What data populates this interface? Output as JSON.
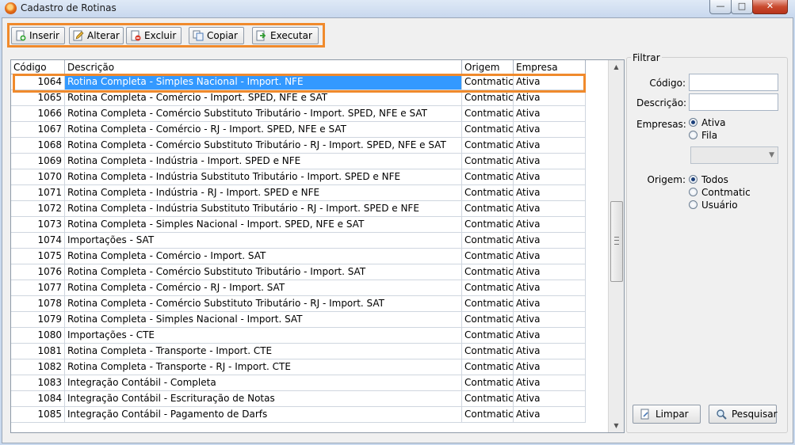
{
  "window": {
    "title": "Cadastro de Rotinas",
    "controls": {
      "minimize": "—",
      "maximize": "□",
      "close": "✕"
    }
  },
  "toolbar": {
    "buttons": [
      {
        "label": "Inserir",
        "icon": "insert-doc-icon"
      },
      {
        "label": "Alterar",
        "icon": "edit-pencil-icon"
      },
      {
        "label": "Excluir",
        "icon": "delete-doc-icon"
      },
      {
        "label": "Copiar",
        "icon": "copy-icon"
      },
      {
        "label": "Executar",
        "icon": "execute-arrow-icon"
      }
    ]
  },
  "grid": {
    "columns": [
      "Código",
      "Descrição",
      "Origem",
      "Empresa"
    ],
    "selected_index": 0,
    "rows": [
      {
        "code": "1064",
        "desc": "Rotina Completa - Simples Nacional - Import. NFE",
        "orig": "Contmatic",
        "emp": "Ativa"
      },
      {
        "code": "1065",
        "desc": "Rotina Completa - Comércio - Import. SPED, NFE e SAT",
        "orig": "Contmatic",
        "emp": "Ativa"
      },
      {
        "code": "1066",
        "desc": "Rotina Completa - Comércio Substituto Tributário - Import. SPED, NFE e SAT",
        "orig": "Contmatic",
        "emp": "Ativa"
      },
      {
        "code": "1067",
        "desc": "Rotina Completa - Comércio - RJ - Import. SPED, NFE e SAT",
        "orig": "Contmatic",
        "emp": "Ativa"
      },
      {
        "code": "1068",
        "desc": "Rotina Completa - Comércio Substituto Tributário - RJ - Import. SPED, NFE e SAT",
        "orig": "Contmatic",
        "emp": "Ativa"
      },
      {
        "code": "1069",
        "desc": "Rotina Completa - Indústria - Import. SPED e NFE",
        "orig": "Contmatic",
        "emp": "Ativa"
      },
      {
        "code": "1070",
        "desc": "Rotina Completa - Indústria Substituto Tributário - Import. SPED e NFE",
        "orig": "Contmatic",
        "emp": "Ativa"
      },
      {
        "code": "1071",
        "desc": "Rotina Completa - Indústria - RJ - Import. SPED e NFE",
        "orig": "Contmatic",
        "emp": "Ativa"
      },
      {
        "code": "1072",
        "desc": "Rotina Completa - Indústria Substituto Tributário - RJ - Import. SPED e NFE",
        "orig": "Contmatic",
        "emp": "Ativa"
      },
      {
        "code": "1073",
        "desc": "Rotina Completa - Simples Nacional - Import. SPED, NFE e SAT",
        "orig": "Contmatic",
        "emp": "Ativa"
      },
      {
        "code": "1074",
        "desc": "Importações - SAT",
        "orig": "Contmatic",
        "emp": "Ativa"
      },
      {
        "code": "1075",
        "desc": "Rotina Completa - Comércio - Import. SAT",
        "orig": "Contmatic",
        "emp": "Ativa"
      },
      {
        "code": "1076",
        "desc": "Rotina Completa - Comércio Substituto Tributário - Import. SAT",
        "orig": "Contmatic",
        "emp": "Ativa"
      },
      {
        "code": "1077",
        "desc": "Rotina Completa - Comércio - RJ - Import. SAT",
        "orig": "Contmatic",
        "emp": "Ativa"
      },
      {
        "code": "1078",
        "desc": "Rotina Completa - Comércio Substituto Tributário - RJ - Import. SAT",
        "orig": "Contmatic",
        "emp": "Ativa"
      },
      {
        "code": "1079",
        "desc": "Rotina Completa - Simples Nacional - Import. SAT",
        "orig": "Contmatic",
        "emp": "Ativa"
      },
      {
        "code": "1080",
        "desc": "Importações - CTE",
        "orig": "Contmatic",
        "emp": "Ativa"
      },
      {
        "code": "1081",
        "desc": "Rotina Completa - Transporte - Import. CTE",
        "orig": "Contmatic",
        "emp": "Ativa"
      },
      {
        "code": "1082",
        "desc": "Rotina Completa - Transporte - RJ - Import. CTE",
        "orig": "Contmatic",
        "emp": "Ativa"
      },
      {
        "code": "1083",
        "desc": "Integração Contábil - Completa",
        "orig": "Contmatic",
        "emp": "Ativa"
      },
      {
        "code": "1084",
        "desc": "Integração Contábil - Escrituração de Notas",
        "orig": "Contmatic",
        "emp": "Ativa"
      },
      {
        "code": "1085",
        "desc": "Integração Contábil - Pagamento de Darfs",
        "orig": "Contmatic",
        "emp": "Ativa"
      }
    ]
  },
  "filter": {
    "title": "Filtrar",
    "codigo_label": "Código:",
    "codigo_value": "",
    "descricao_label": "Descrição:",
    "descricao_value": "",
    "empresas_label": "Empresas:",
    "empresas_options": [
      {
        "label": "Ativa",
        "checked": true
      },
      {
        "label": "Fila",
        "checked": false
      }
    ],
    "combo_value": "",
    "origem_label": "Origem:",
    "origem_options": [
      {
        "label": "Todos",
        "checked": true
      },
      {
        "label": "Contmatic",
        "checked": false
      },
      {
        "label": "Usuário",
        "checked": false
      }
    ],
    "clear_label": "Limpar",
    "search_label": "Pesquisar"
  },
  "colors": {
    "highlight_orange": "#f08a2c",
    "selection_blue": "#3399ff"
  }
}
